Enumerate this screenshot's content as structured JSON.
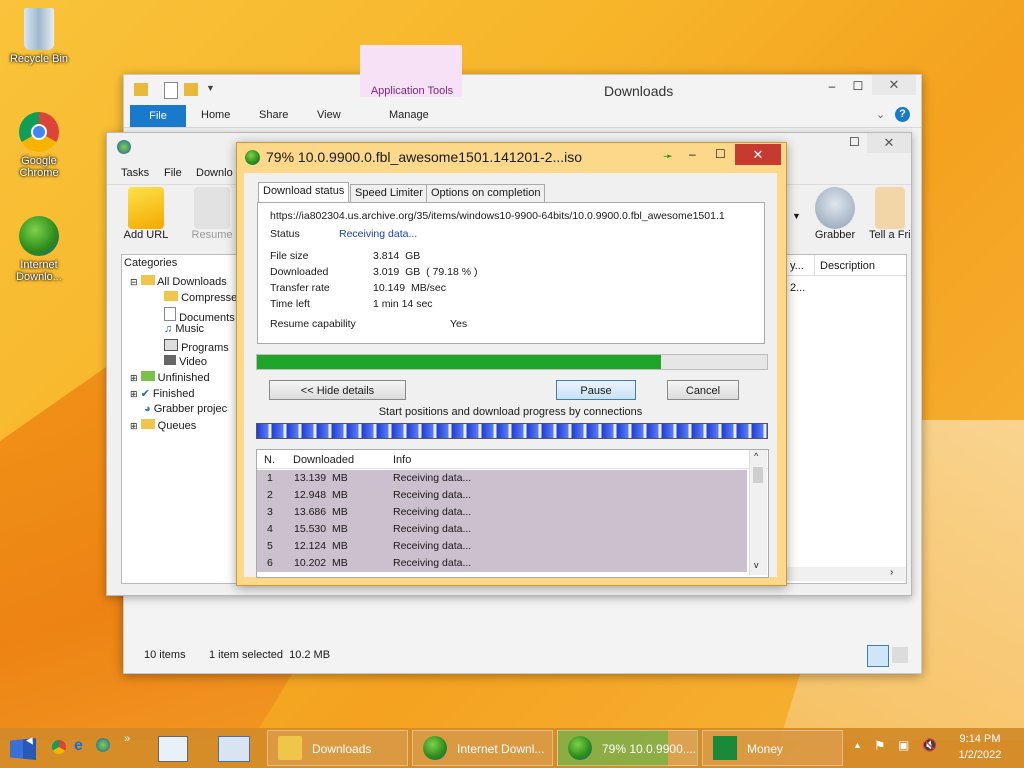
{
  "desktop": {
    "icons": [
      {
        "label": "Recycle Bin"
      },
      {
        "label": "Google Chrome"
      },
      {
        "label": "Internet Downlo..."
      }
    ]
  },
  "explorer": {
    "title": "Downloads",
    "app_tools": "Application Tools",
    "tabs": [
      "File",
      "Home",
      "Share",
      "View",
      "Manage"
    ],
    "status_items": "10 items",
    "status_selected": "1 item selected  10.2 MB"
  },
  "idm": {
    "menu": [
      "Tasks",
      "File",
      "Downlo"
    ],
    "toolbar": {
      "add_url": "Add URL",
      "resume": "Resume",
      "grabber": "Grabber",
      "tell": "Tell a Fri"
    },
    "categories_title": "Categories",
    "tree": [
      {
        "label": "All Downloads"
      },
      {
        "label": "Compresse"
      },
      {
        "label": "Documents"
      },
      {
        "label": "Music"
      },
      {
        "label": "Programs"
      },
      {
        "label": "Video"
      },
      {
        "label": "Unfinished"
      },
      {
        "label": "Finished"
      },
      {
        "label": "Grabber projec"
      },
      {
        "label": "Queues"
      }
    ],
    "col_partial": "y...",
    "col_description": "Description",
    "cell_partial": "2..."
  },
  "dialog": {
    "title": "79% 10.0.9900.0.fbl_awesome1501.141201-2...iso",
    "tabs": [
      "Download status",
      "Speed Limiter",
      "Options on completion"
    ],
    "url": "https://ia802304.us.archive.org/35/items/windows10-9900-64bits/10.0.9900.0.fbl_awesome1501.1",
    "status_label": "Status",
    "status_value": "Receiving data...",
    "file_size_label": "File size",
    "file_size_value": "3.814  GB",
    "downloaded_label": "Downloaded",
    "downloaded_value": "3.019  GB  ( 79.18 % )",
    "rate_label": "Transfer rate",
    "rate_value": "10.149  MB/sec",
    "time_label": "Time left",
    "time_value": "1 min 14 sec",
    "resume_label": "Resume capability",
    "resume_value": "Yes",
    "progress": 0.7918,
    "hide_details": "<< Hide details",
    "pause": "Pause",
    "cancel": "Cancel",
    "connections_caption": "Start positions and download progress by connections",
    "list_headers": [
      "N.",
      "Downloaded",
      "Info"
    ],
    "connections": [
      {
        "n": "1",
        "downloaded": "13.139  MB",
        "info": "Receiving data..."
      },
      {
        "n": "2",
        "downloaded": "12.948  MB",
        "info": "Receiving data..."
      },
      {
        "n": "3",
        "downloaded": "13.686  MB",
        "info": "Receiving data..."
      },
      {
        "n": "4",
        "downloaded": "15.530  MB",
        "info": "Receiving data..."
      },
      {
        "n": "5",
        "downloaded": "12.124  MB",
        "info": "Receiving data..."
      },
      {
        "n": "6",
        "downloaded": "10.202  MB",
        "info": "Receiving data..."
      }
    ]
  },
  "taskbar": {
    "buttons": [
      {
        "label": "Downloads"
      },
      {
        "label": "Internet Downl..."
      },
      {
        "label": "79% 10.0.9900...."
      },
      {
        "label": "Money"
      }
    ],
    "time": "9:14 PM",
    "date": "1/2/2022"
  },
  "colors": {
    "accent": "#1979ca",
    "progress": "#1ea52a",
    "dialog_frame": "#fbd88a",
    "close": "#c73a30"
  }
}
